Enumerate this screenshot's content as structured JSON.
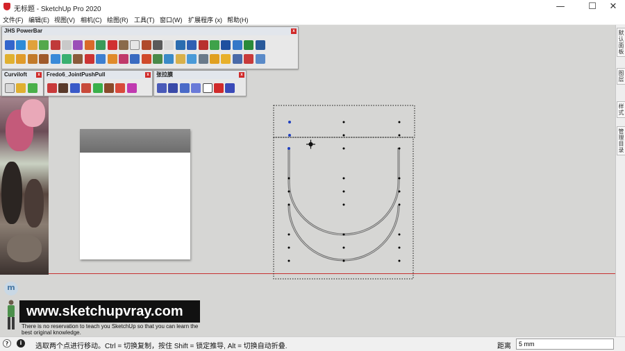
{
  "window": {
    "title": "无标题 - SketchUp Pro 2020"
  },
  "menu": {
    "items": [
      "文件(F)",
      "编辑(E)",
      "视图(V)",
      "相机(C)",
      "绘图(R)",
      "工具(T)",
      "窗口(W)",
      "扩展程序 (x)",
      "帮助(H)"
    ]
  },
  "toolbars": {
    "jhs": {
      "title": "JHS PowerBar"
    },
    "curviloft": {
      "title": "Curviloft"
    },
    "fredo": {
      "title": "Fredo6_JointPushPull"
    },
    "zhanglamo": {
      "title": "张拉膜"
    },
    "close_glyph": "x"
  },
  "side_tabs": [
    "默认面板",
    "图层",
    "样式",
    "管理目录"
  ],
  "viewport": {
    "cursor_icon": "move-cursor-icon"
  },
  "watermark": {
    "logo_letter": "m",
    "url": "www.sketchupvray.com",
    "tagline": "There is no reservation to teach you SketchUp so that you can learn the best original knowledge."
  },
  "status": {
    "hint": "选取两个点进行移动。Ctrl = 切换复制，按住 Shift = 锁定推导, Alt = 切换自动折叠.",
    "measure_label": "距离",
    "measure_value": "5 mm",
    "info_glyph": "i",
    "help_glyph": "?"
  },
  "colors": {
    "viewport_bg": "#d6d6d4",
    "horizon_line": "#c62f2f",
    "selection_vertex": "#1f3fbf",
    "toolbar_close": "#d02a2a"
  }
}
